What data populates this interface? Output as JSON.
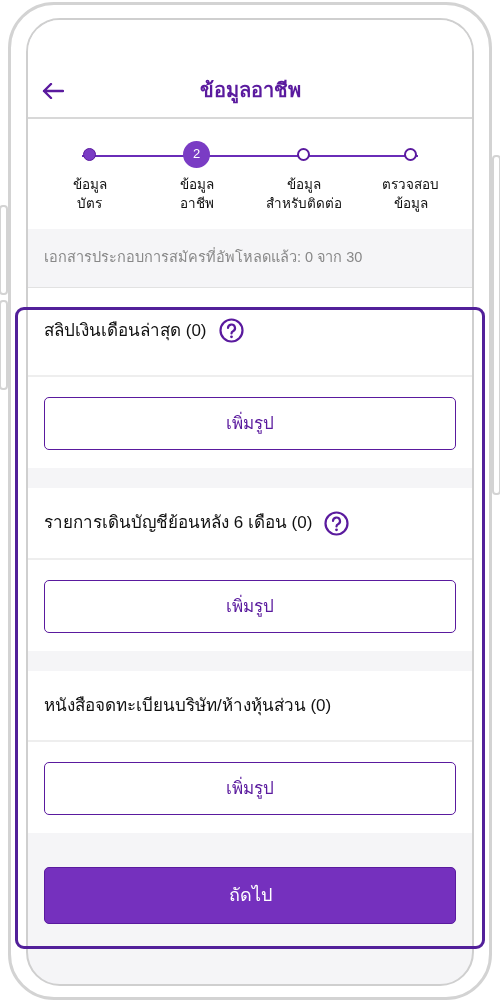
{
  "header": {
    "title": "ข้อมูลอาชีพ"
  },
  "steps": [
    {
      "label": [
        "ข้อมูล",
        "บัตร"
      ],
      "completed": true,
      "selected": false
    },
    {
      "number": "2",
      "label": [
        "ข้อมูล",
        "อาชีพ"
      ],
      "completed": false,
      "selected": true
    },
    {
      "label": [
        "ข้อมูล",
        "สำหรับติดต่อ"
      ],
      "completed": false,
      "selected": false
    },
    {
      "label": [
        "ตรวจสอบ",
        "ข้อมูล"
      ],
      "completed": false,
      "selected": false
    }
  ],
  "upload_status": "เอกสารประกอบการสมัครที่อัพโหลดแล้ว: 0 จาก 30",
  "documents_highlighted": true,
  "documents": [
    {
      "title": "สลิปเงินเดือนล่าสุด (0)",
      "help": true,
      "button": "เพิ่มรูป"
    },
    {
      "title": "รายการเดินบัญชีย้อนหลัง 6 เดือน (0)",
      "help": true,
      "button": "เพิ่มรูป"
    },
    {
      "title": "หนังสือจดทะเบียนบริษัท/ห้างหุ้นส่วน (0)",
      "help": false,
      "button": "เพิ่มรูป"
    }
  ],
  "next_button": "ถัดไป"
}
